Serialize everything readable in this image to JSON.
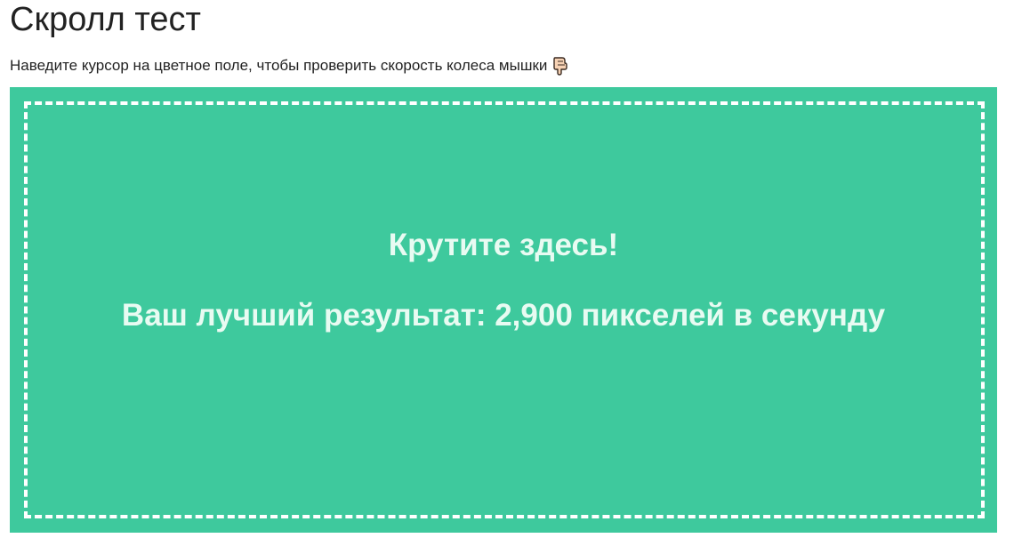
{
  "header": {
    "title": "Скролл тест"
  },
  "instruction": {
    "text": "Наведите курсор на цветное поле, чтобы проверить скорость колеса мышки",
    "icon": "pointing-down-hand-icon"
  },
  "scroll_area": {
    "prompt": "Крутите здесь!",
    "best_result": "Ваш лучший результат: 2,900 пикселей в секунду",
    "background_color": "#3ec99d",
    "border_color": "#ffffff"
  }
}
